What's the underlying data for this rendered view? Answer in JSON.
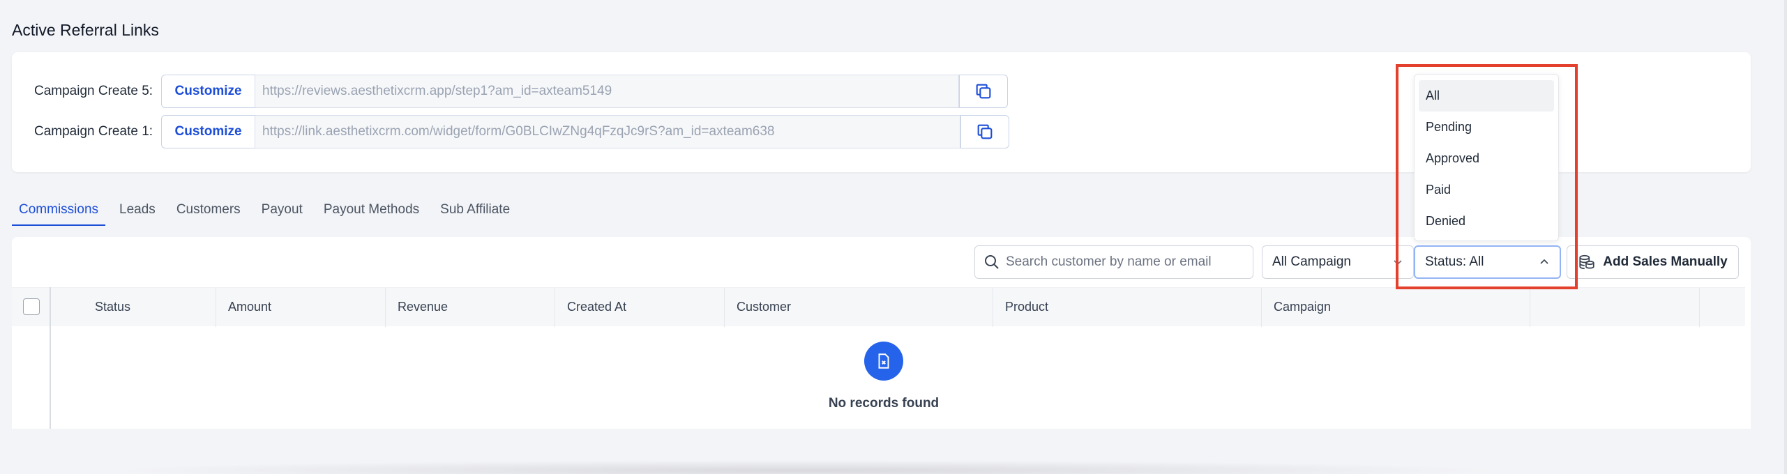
{
  "page_title": "Active Referral Links",
  "referral_links": [
    {
      "label": "Campaign Create 5:",
      "customize_label": "Customize",
      "url": "https://reviews.aesthetixcrm.app/step1?am_id=axteam5149"
    },
    {
      "label": "Campaign Create 1:",
      "customize_label": "Customize",
      "url": "https://link.aesthetixcrm.com/widget/form/G0BLCIwZNg4qFzqJc9rS?am_id=axteam638"
    }
  ],
  "tabs": [
    {
      "label": "Commissions",
      "active": true
    },
    {
      "label": "Leads",
      "active": false
    },
    {
      "label": "Customers",
      "active": false
    },
    {
      "label": "Payout",
      "active": false
    },
    {
      "label": "Payout Methods",
      "active": false
    },
    {
      "label": "Sub Affiliate",
      "active": false
    }
  ],
  "toolbar": {
    "search_placeholder": "Search customer by name or email",
    "campaign_select": "All Campaign",
    "status_select": "Status: All",
    "add_sales_label": "Add Sales Manually"
  },
  "table": {
    "columns": [
      "Status",
      "Amount",
      "Revenue",
      "Created At",
      "Customer",
      "Product",
      "Campaign",
      ""
    ],
    "empty_text": "No records found"
  },
  "status_dropdown": {
    "options": [
      "All",
      "Pending",
      "Approved",
      "Paid",
      "Denied"
    ],
    "selected": "All"
  },
  "colors": {
    "accent": "#1d4ed8",
    "highlight": "#e3402d",
    "background": "#f3f4f7"
  }
}
